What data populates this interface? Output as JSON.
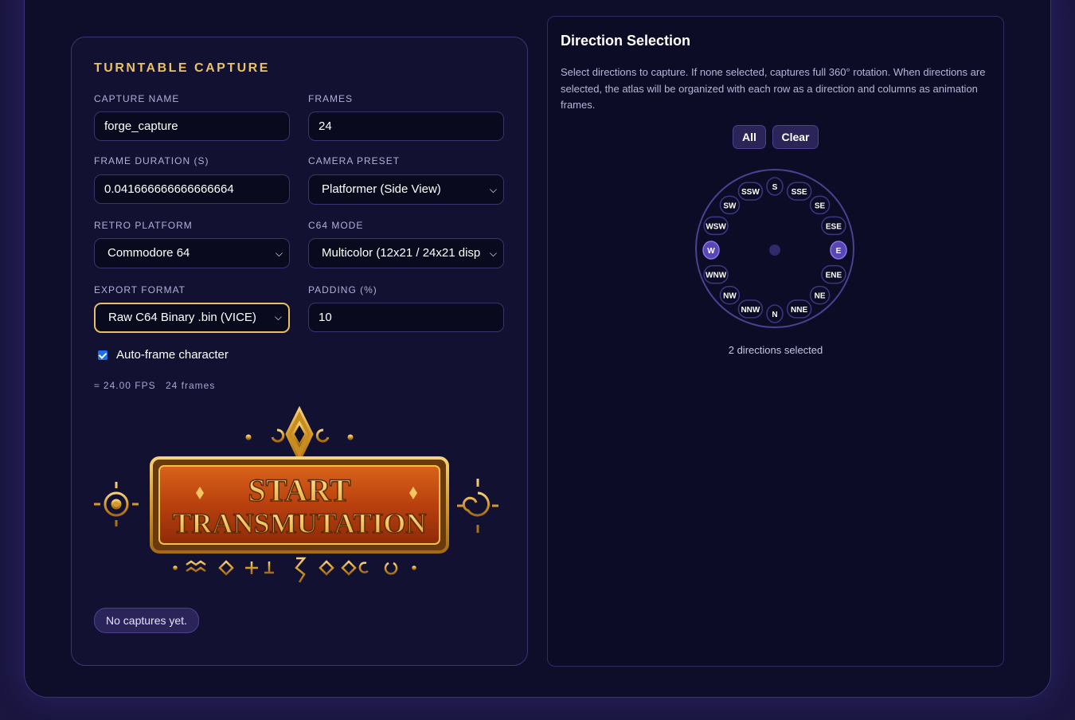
{
  "left_panel": {
    "title": "TURNTABLE CAPTURE",
    "capture_name": {
      "label": "CAPTURE NAME",
      "value": "forge_capture"
    },
    "frames": {
      "label": "FRAMES",
      "value": "24"
    },
    "frame_duration": {
      "label": "FRAME DURATION (S)",
      "value": "0.041666666666666664"
    },
    "camera_preset": {
      "label": "CAMERA PRESET",
      "value": "Platformer (Side View)"
    },
    "retro_platform": {
      "label": "RETRO PLATFORM",
      "value": "Commodore 64"
    },
    "c64_mode": {
      "label": "C64 MODE",
      "value": "Multicolor (12x21 / 24x21 disp"
    },
    "export_format": {
      "label": "EXPORT FORMAT",
      "value": "Raw C64 Binary .bin (VICE)"
    },
    "padding": {
      "label": "PADDING (%)",
      "value": "10"
    },
    "auto_frame": {
      "label": "Auto-frame character",
      "checked": true
    },
    "fps_text": "≈ 24.00 FPS",
    "frames_text": "24 frames",
    "start_button": {
      "line1": "START",
      "line2": "TRANSMUTATION"
    },
    "status": "No captures yet."
  },
  "right_panel": {
    "title": "Direction Selection",
    "description": "Select directions to capture. If none selected, captures full 360° rotation. When directions are selected, the atlas will be organized with each row as a direction and columns as animation frames.",
    "all_label": "All",
    "clear_label": "Clear",
    "directions": [
      "S",
      "SSE",
      "SE",
      "ESE",
      "E",
      "ENE",
      "NE",
      "NNE",
      "N",
      "NNW",
      "NW",
      "WNW",
      "W",
      "WSW",
      "SW",
      "SSW"
    ],
    "selected": [
      "E",
      "W"
    ],
    "count_text": "2 directions selected"
  },
  "colors": {
    "accent_gold": "#e8c268",
    "selected_dir": "#5a45b5",
    "panel_bg": "#121131"
  }
}
